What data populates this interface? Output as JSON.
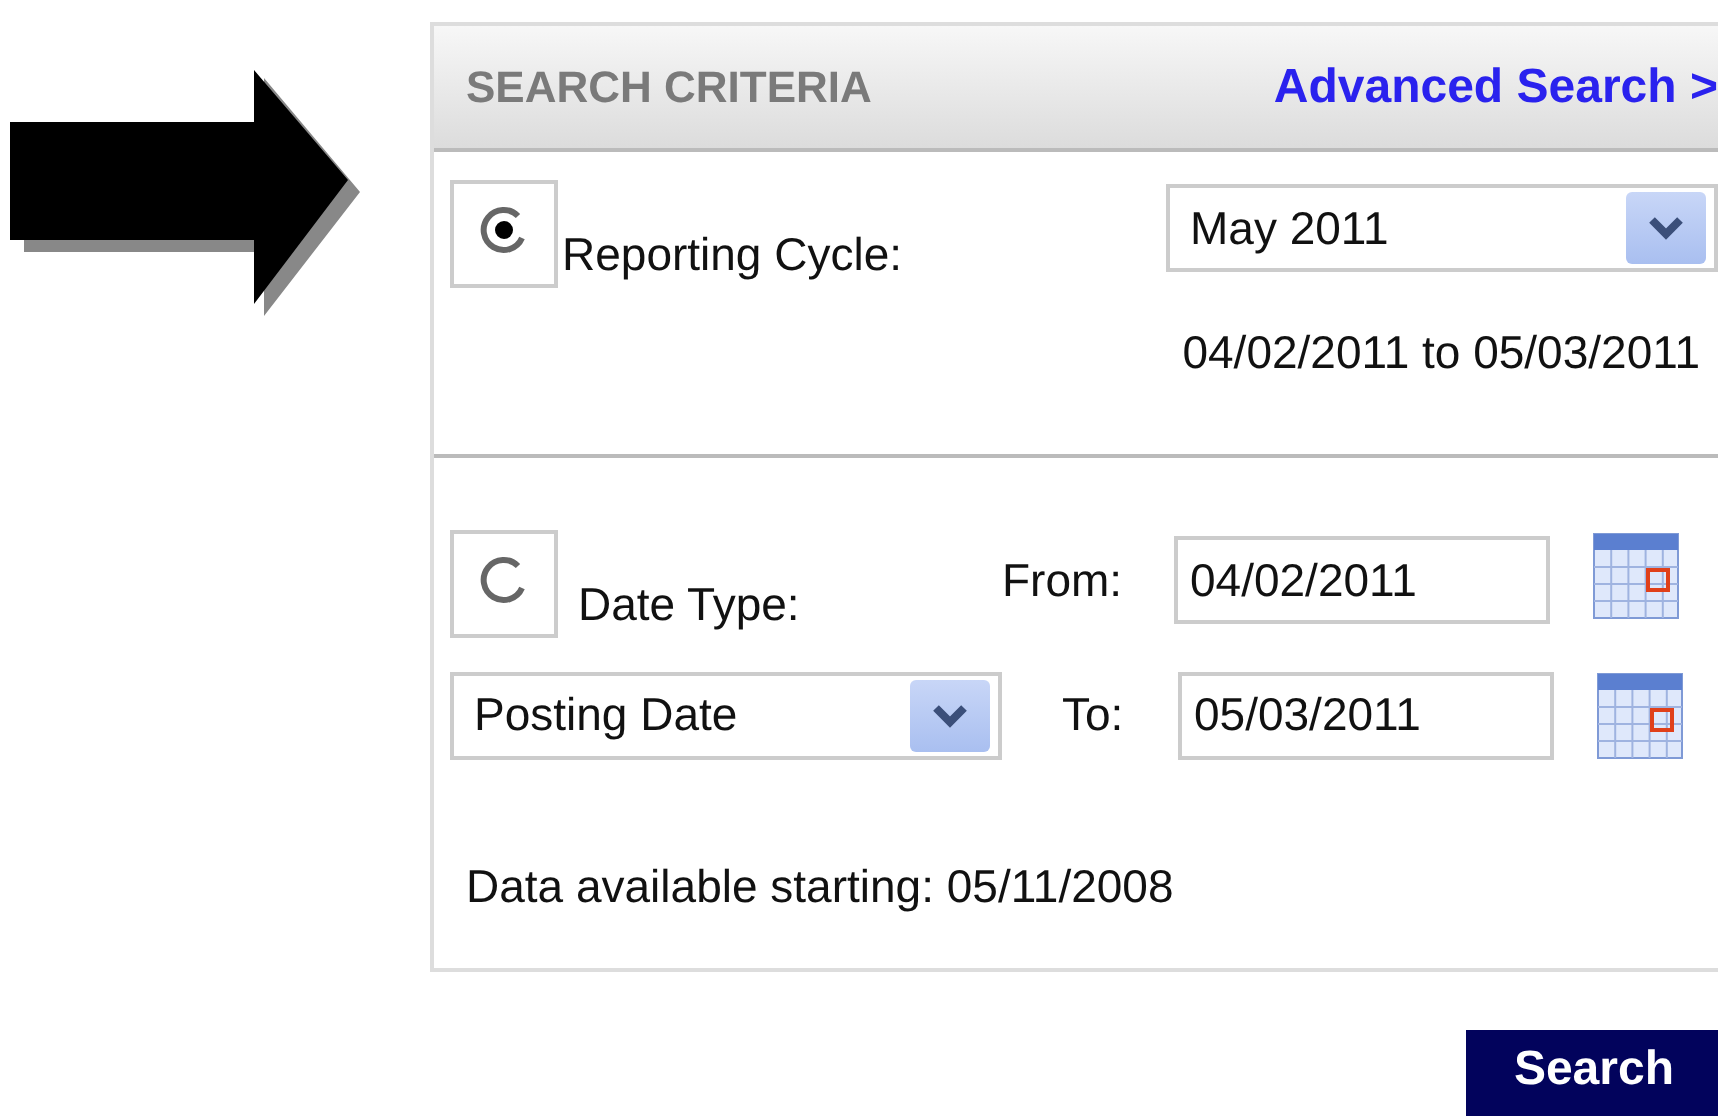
{
  "header": {
    "title": "SEARCH CRITERIA",
    "link": "Advanced Search >"
  },
  "reporting_cycle": {
    "selected": true,
    "label": "Reporting Cycle:",
    "value": "May 2011",
    "range": "04/02/2011 to 05/03/2011"
  },
  "date_type": {
    "selected": false,
    "label": "Date Type:",
    "type_value": "Posting Date",
    "from_label": "From:",
    "from_value": "04/02/2011",
    "to_label": "To:",
    "to_value": "05/03/2011"
  },
  "availability": "Data available starting: 05/11/2008",
  "search_button": "Search"
}
